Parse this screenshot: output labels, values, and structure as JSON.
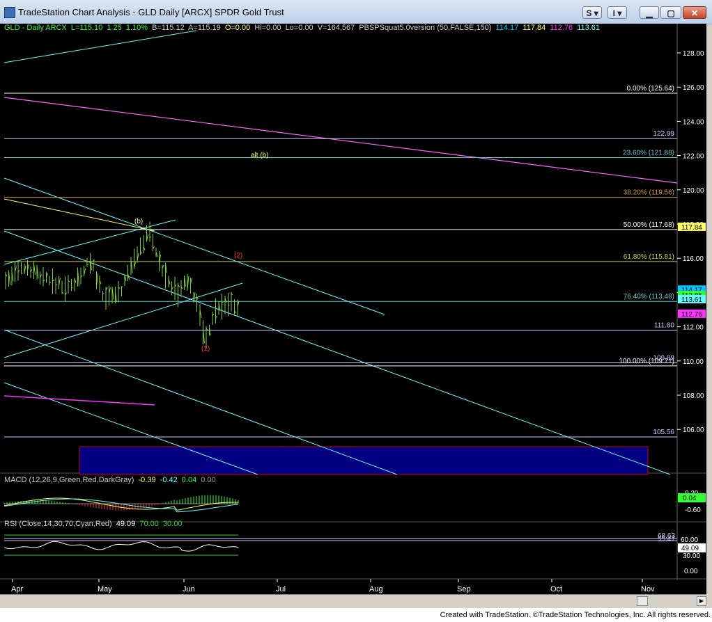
{
  "window": {
    "title": "TradeStation Chart Analysis - GLD Daily [ARCX] SPDR Gold Trust",
    "buttons": [
      "S",
      "I"
    ]
  },
  "header": {
    "symbol": "GLD - Daily  ARCX",
    "fields": [
      "L=115.10",
      "1.25",
      "1.10%",
      "B=115.12",
      "A=115.19",
      "O=0.00",
      "Hi=0.00",
      "Lo=0.00",
      "V=164,567",
      "PBSPSquat5.0version (50,FALSE,150)"
    ],
    "indicator_values": [
      "114.17",
      "117.84",
      "112.76",
      "113.61"
    ],
    "indicator_colors": [
      "#00c8ff",
      "#ffff66",
      "#ff33ff",
      "#66ffff"
    ]
  },
  "price_axis": {
    "ticks": [
      "128.00",
      "126.00",
      "124.00",
      "122.00",
      "120.00",
      "118.00",
      "116.00",
      "114.00",
      "112.00",
      "110.00",
      "108.00",
      "106.00"
    ],
    "tick_values": [
      128,
      126,
      124,
      122,
      120,
      118,
      116,
      114,
      112,
      110,
      108,
      106
    ],
    "flags": [
      {
        "text": "117.84",
        "value": 117.84,
        "bg": "#ffff66"
      },
      {
        "text": "114.17",
        "value": 114.17,
        "bg": "#00c8ff"
      },
      {
        "text": "113.85",
        "value": 113.85,
        "bg": "#33ff33"
      },
      {
        "text": "113.61",
        "value": 113.61,
        "bg": "#66ffff"
      },
      {
        "text": "112.76",
        "value": 112.76,
        "bg": "#ff33ff"
      }
    ]
  },
  "levels": [
    {
      "label": "0.00% (125.64)",
      "value": 125.64,
      "color": "#ffffff"
    },
    {
      "label": "122.99",
      "value": 122.99,
      "color": "#ccccff"
    },
    {
      "label": "23.60% (121.88)",
      "value": 121.88,
      "color": "#66cccc"
    },
    {
      "label": "38.20% (119.56)",
      "value": 119.56,
      "color": "#cc9933"
    },
    {
      "label": "50.00% (117.68)",
      "value": 117.68,
      "color": "#ffffff"
    },
    {
      "label": "61.80% (115.81)",
      "value": 115.81,
      "color": "#cccc33"
    },
    {
      "label": "76.40% (113.48)",
      "value": 113.48,
      "color": "#66cccc"
    },
    {
      "label": "111.80",
      "value": 111.8,
      "color": "#ccccff"
    },
    {
      "label": "100.00% (109.71)",
      "value": 109.71,
      "color": "#ffffff"
    },
    {
      "label": "109.89",
      "value": 109.89,
      "color": "#ccccff"
    },
    {
      "label": "105.56",
      "value": 105.56,
      "color": "#ccccff"
    }
  ],
  "annotations": [
    {
      "text": "alt (b)",
      "color": "#ffff66"
    },
    {
      "text": "(b)",
      "color": "#ffff66"
    },
    {
      "text": "(2)",
      "color": "#ff3333"
    },
    {
      "text": "(1)",
      "color": "#ff3333"
    }
  ],
  "time_axis": {
    "labels": [
      "Apr",
      "May",
      "Jun",
      "Jul",
      "Aug",
      "Sep",
      "Oct",
      "Nov"
    ]
  },
  "macd": {
    "label": "MACD (12,26,9,Green,Red,DarkGray)",
    "values": [
      "-0.39",
      "-0.42",
      "0.04",
      "0.00"
    ],
    "value_colors": [
      "#ffff66",
      "#66ffff",
      "#33ff33",
      "#999999"
    ],
    "ticks": [
      "0.20",
      "-0.60"
    ],
    "flag": "0.04"
  },
  "rsi": {
    "label": "RSI (Close,14,30,70,Cyan,Red)",
    "values": [
      "49.09",
      "70.00",
      "30.00"
    ],
    "value_colors": [
      "#ffffff",
      "#33cc33",
      "#33cc33"
    ],
    "ticks": [
      "60.00",
      "30.00",
      "0.00"
    ],
    "level_labels": [
      "68.63",
      "55.47"
    ],
    "flag": "49.09"
  },
  "footer": "Created with TradeStation. ©TradeStation Technologies, Inc. All rights reserved."
}
